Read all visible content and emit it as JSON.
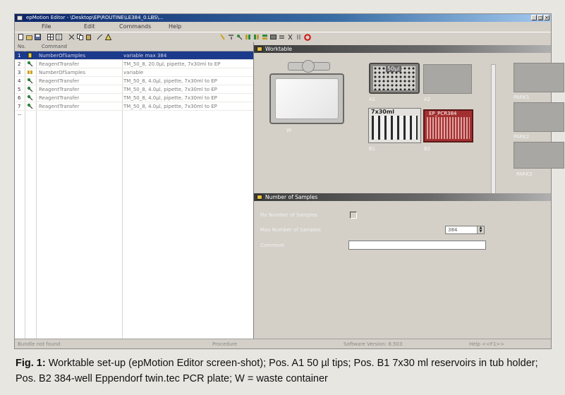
{
  "window": {
    "title": "epMotion Editor - \\Desktop\\EP\\ROUTINE\\LE384_0.LBS\\...",
    "controls": [
      "_",
      "□",
      "×"
    ]
  },
  "menu": [
    "File",
    "Edit",
    "Commands",
    "Help"
  ],
  "command_list": {
    "headers": {
      "no": "No.",
      "command": "Command"
    },
    "rows": [
      {
        "no": "1",
        "command": "NumberOfSamples",
        "params": "variable max 384",
        "selected": true
      },
      {
        "no": "2",
        "command": "ReagentTransfer",
        "params": "TM_50_8, 20.0µl, pipette, 7x30ml to EP"
      },
      {
        "no": "3",
        "command": "NumberOfSamples",
        "params": "variable"
      },
      {
        "no": "4",
        "command": "ReagentTransfer",
        "params": "TM_50_8, 4.0µl, pipette, 7x30ml to EP"
      },
      {
        "no": "5",
        "command": "ReagentTransfer",
        "params": "TM_50_8, 4.0µl, pipette, 7x30ml to EP"
      },
      {
        "no": "6",
        "command": "ReagentTransfer",
        "params": "TM_50_8, 4.0µl, pipette, 7x30ml to EP"
      },
      {
        "no": "7",
        "command": "ReagentTransfer",
        "params": "TM_50_8, 4.0µl, pipette, 7x30ml to EP"
      },
      {
        "no": "--",
        "command": "",
        "params": ""
      }
    ]
  },
  "worktable": {
    "title": "Worktable",
    "positions": {
      "waste": "W",
      "a1": "A1",
      "a1_tip_label": "50µl",
      "a2": "A2",
      "b1": "B1",
      "b1_reservoir_label": "7x30ml",
      "b2": "B2",
      "b2_plate_label": "EP_PCR384",
      "park1": "PARK1",
      "park2": "PARK2",
      "park3": "PARK3"
    }
  },
  "number_of_samples": {
    "title": "Number of Samples",
    "fix_label": "Fix Number of Samples",
    "fix_checked": false,
    "max_label": "Max Number of Samples",
    "max_value": "384",
    "comment_label": "Comment",
    "comment_value": ""
  },
  "statusbar": {
    "left": "Bundle not found",
    "middle": "Procedure",
    "version": "Software Version: 8.503",
    "help": "Help <<F1>>"
  },
  "caption": {
    "label": "Fig. 1:",
    "text": " Worktable set-up (epMotion Editor screen-shot); Pos. A1 50 µl tips; Pos. B1 7x30 ml reservoirs in tub holder; Pos. B2 384-well Eppendorf twin.tec PCR plate; W = waste container"
  },
  "colors": {
    "selection": "#1c3a8c",
    "title_gradient_start": "#0a246a",
    "slot_gray": "#a9a7a3",
    "plate_pink": "#d89a9a",
    "stop_red": "#d01010"
  }
}
